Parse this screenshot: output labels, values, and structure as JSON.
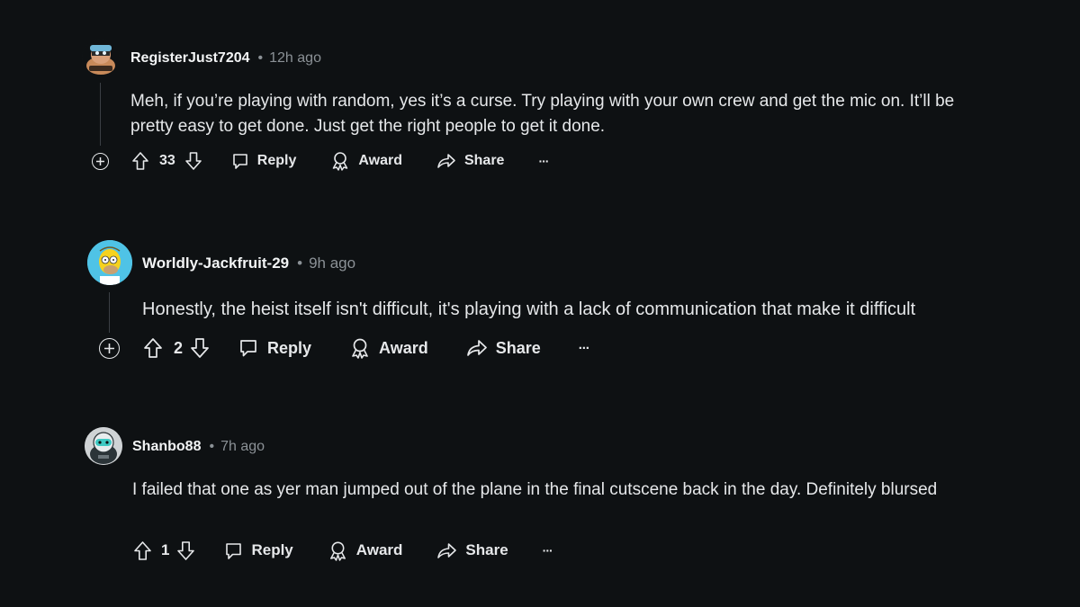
{
  "comments": [
    {
      "author": "RegisterJust7204",
      "separator": "•",
      "time": "12h ago",
      "body_line1": "Meh, if you’re playing with random, yes it’s a curse. Try playing with your own crew and get the mic on. It’ll be",
      "body_line2": "pretty easy to get done. Just get the right people to get it done.",
      "votes": "33",
      "reply": "Reply",
      "award": "Award",
      "share": "Share",
      "more": "···"
    },
    {
      "author": "Worldly-Jackfruit-29",
      "separator": "•",
      "time": "9h ago",
      "body_line1": "Honestly, the heist itself isn't difficult, it's playing with a lack of communication that make it difficult",
      "votes": "2",
      "reply": "Reply",
      "award": "Award",
      "share": "Share",
      "more": "···"
    },
    {
      "author": "Shanbo88",
      "separator": "•",
      "time": "7h ago",
      "body_line1": "I failed that one as yer man jumped out of the plane in the final cutscene back in the day. Definitely blursed",
      "votes": "1",
      "reply": "Reply",
      "award": "Award",
      "share": "Share",
      "more": "···"
    }
  ]
}
